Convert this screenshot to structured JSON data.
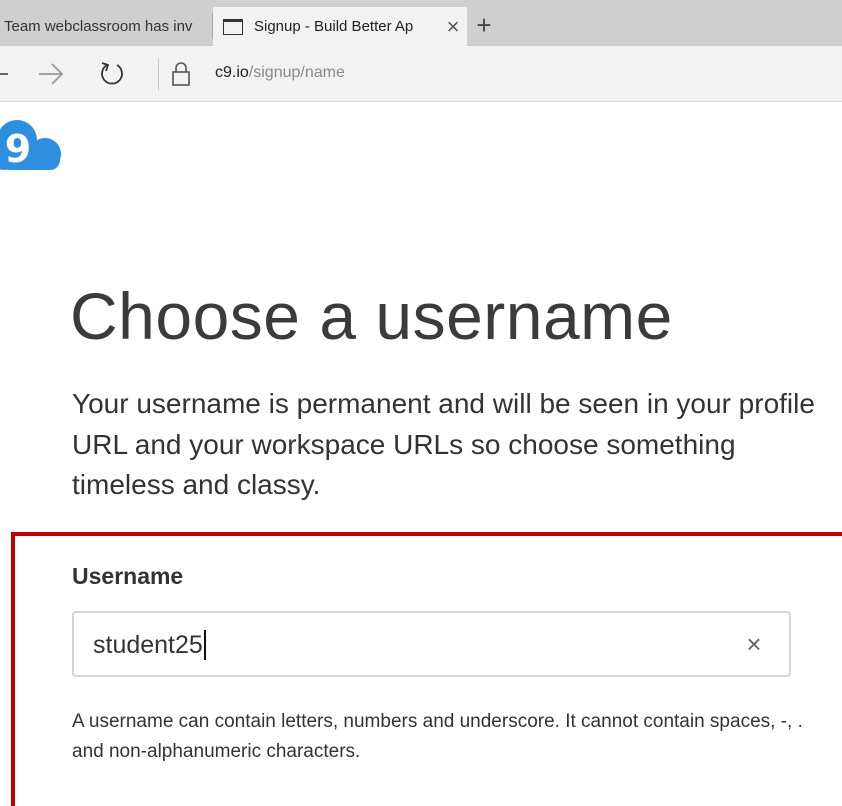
{
  "browser": {
    "tabs": [
      {
        "title": "Team webclassroom has inv",
        "active": false
      },
      {
        "title": "Signup - Build Better Ap",
        "active": true
      }
    ],
    "close_glyph": "×",
    "new_tab_glyph": "+",
    "address": {
      "host": "c9.io",
      "path": "/signup/name"
    }
  },
  "logo": {
    "text": "9",
    "color": "#2e8fe0"
  },
  "page": {
    "heading": "Choose a username",
    "intro": "Your username is permanent and will be seen in your profile URL and your workspace URLs so choose something timeless and classy.",
    "username_field": {
      "label": "Username",
      "value": "student25",
      "clear_glyph": "×"
    },
    "help": "A username can contain letters, numbers and underscore. It cannot contain spaces, -, . and non-alphanumeric characters."
  },
  "colors": {
    "highlight_border": "#c00000",
    "tabstrip": "#cfcfcf",
    "toolbar": "#f2f2f2"
  }
}
